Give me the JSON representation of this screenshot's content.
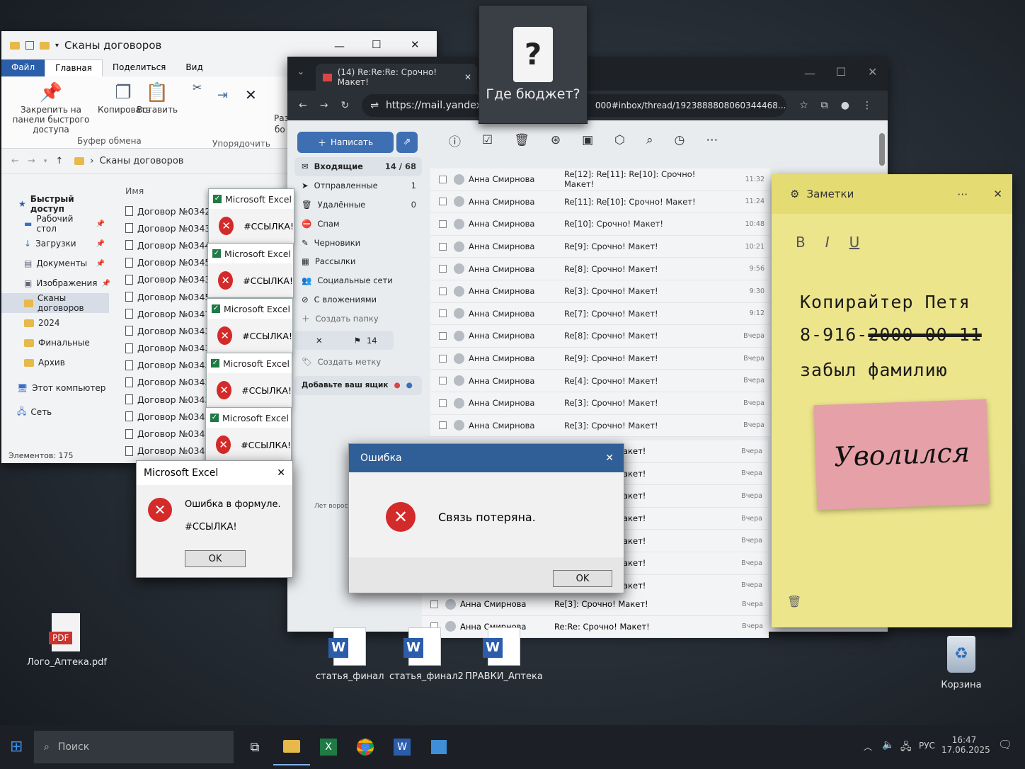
{
  "explorer": {
    "title": "Сканы договоров",
    "tabs": [
      "Файл",
      "Главная",
      "Поделиться",
      "Вид"
    ],
    "ribbon": {
      "pin": "Закрепить на панели быстрого доступа",
      "copy": "Копировать",
      "paste": "Вставить",
      "group_clipboard": "Буфер обмена",
      "group_organize": "Упорядочить",
      "cut_fragment": "Раз",
      "cut_fragment2": "бо"
    },
    "address": "Сканы договоров",
    "col_name": "Имя",
    "nav": [
      {
        "label": "Быстрый доступ"
      },
      {
        "label": "Рабочий стол"
      },
      {
        "label": "Загрузки"
      },
      {
        "label": "Документы"
      },
      {
        "label": "Изображения"
      },
      {
        "label": "Сканы договоров"
      },
      {
        "label": "2024"
      },
      {
        "label": "Финальные"
      },
      {
        "label": "Архив"
      },
      {
        "label": "Этот компьютер"
      },
      {
        "label": "Сеть"
      }
    ],
    "files": [
      "Договор №0342_",
      "Договор №0343_",
      "Договор №0344_",
      "Договор №0345_",
      "Договор №0343_",
      "Договор №0345_",
      "Договор №0347_",
      "Договор №0343_",
      "Договор №0343_",
      "Договор №0343_",
      "Договор №0343_",
      "Договор №0343_",
      "Договор №0343_",
      "Договор №0343_",
      "Договор №0343_"
    ],
    "status": "Элементов: 175"
  },
  "excel_stack": {
    "title": "Microsoft Excel",
    "text": "#ССЫЛКА!"
  },
  "excel_dialog": {
    "title": "Microsoft Excel",
    "line1": "Ошибка в формуле.",
    "line2": "#ССЫЛКА!",
    "ok": "OK",
    "close": "✕"
  },
  "browser": {
    "tab_title": "(14) Re:Re:Re: Срочно! Макет!",
    "url_left": "https://mail.yandex",
    "url_right": "000#inbox/thread/1923888808060344468...",
    "compose": "Написать",
    "folders": [
      {
        "label": "Входящие",
        "count": "14 / 68"
      },
      {
        "label": "Отправленные",
        "count": "1"
      },
      {
        "label": "Удалённые",
        "count": "0"
      },
      {
        "label": "Спам",
        "count": ""
      },
      {
        "label": "Черновики",
        "count": ""
      },
      {
        "label": "Рассылки",
        "count": ""
      },
      {
        "label": "Социальные сети",
        "count": ""
      },
      {
        "label": "С вложениями",
        "count": ""
      },
      {
        "label": "Создать папку",
        "count": ""
      }
    ],
    "flag_count": "14",
    "create_label": "Создать метку",
    "add_box": "Добавьте ваш ящик",
    "footer_fragment": "Лет ворос",
    "emails": [
      {
        "from": "Анна Смирнова",
        "subject": "Re[12]: Re[11]: Re[10]: Срочно! Макет!",
        "time": "11:32"
      },
      {
        "from": "Анна Смирнова",
        "subject": "Re[11]: Re[10]: Срочно! Макет!",
        "time": "11:24"
      },
      {
        "from": "Анна Смирнова",
        "subject": "Re[10]: Срочно! Макет!",
        "time": "10:48"
      },
      {
        "from": "Анна Смирнова",
        "subject": "Re[9]: Срочно! Макет!",
        "time": "10:21"
      },
      {
        "from": "Анна Смирнова",
        "subject": "Re[8]: Срочно! Макет!",
        "time": "9:56"
      },
      {
        "from": "Анна Смирнова",
        "subject": "Re[3]: Срочно! Макет!",
        "time": "9:30"
      },
      {
        "from": "Анна Смирнова",
        "subject": "Re[7]: Срочно! Макет!",
        "time": "9:12"
      },
      {
        "from": "Анна Смирнова",
        "subject": "Re[8]: Срочно! Макет!",
        "time": "Вчера"
      },
      {
        "from": "Анна Смирнова",
        "subject": "Re[9]: Срочно! Макет!",
        "time": "Вчера"
      },
      {
        "from": "Анна Смирнова",
        "subject": "Re[4]: Срочно! Макет!",
        "time": "Вчера"
      },
      {
        "from": "Анна Смирнова",
        "subject": "Re[3]: Срочно! Макет!",
        "time": "Вчера"
      },
      {
        "from": "Анна Смирнова",
        "subject": "Re[3]: Срочно! Макет!",
        "time": "Вчера"
      }
    ],
    "hidden_rows": [
      {
        "subject": "акет!",
        "time": "Вчера"
      },
      {
        "subject": "акет!",
        "time": "Вчера"
      },
      {
        "subject": "акет!",
        "time": "Вчера"
      },
      {
        "subject": "акет!",
        "time": "Вчера"
      },
      {
        "subject": "акет!",
        "time": "Вчера"
      },
      {
        "subject": "акет!",
        "time": "Вчера"
      },
      {
        "subject": "акет!",
        "time": "Вчера"
      }
    ],
    "bottom_rows": [
      {
        "from": "Анна Смирнова",
        "subject": "Re[3]: Срочно! Макет!",
        "time": "Вчера"
      },
      {
        "from": "Анна Смирнова",
        "subject": "Re:Re: Срочно! Макет!",
        "time": "Вчера"
      }
    ]
  },
  "tooltip": {
    "icon": "?",
    "text": "Где бюджет?"
  },
  "error_dialog": {
    "title": "Ошибка",
    "message": "Связь потеряна.",
    "ok": "OK",
    "close": "✕"
  },
  "notes": {
    "title": "Заметки",
    "bold": "B",
    "italic": "I",
    "underline": "U",
    "line1": "Копирайтер Петя",
    "line2_visible": "8-916-",
    "line2_struck": "2000 00 11",
    "line3": "забыл фамилию",
    "sticky": "Уволился"
  },
  "desktop": {
    "pdf_label": "Лого_Аптека.pdf",
    "pdf_badge": "PDF",
    "word1": "статья_финал",
    "word2": "статья_финал2",
    "word3": "ПРАВКИ_Аптека",
    "recycle": "Корзина"
  },
  "taskbar": {
    "search_placeholder": "Поиск",
    "lang": "РУС",
    "time": "16:47",
    "date": "17.06.2025"
  },
  "colors": {
    "accent": "#2b5ea9",
    "error": "#d32a2a",
    "note": "#ece58c",
    "sticky": "#e6a0a8",
    "excel": "#1f7a45"
  }
}
